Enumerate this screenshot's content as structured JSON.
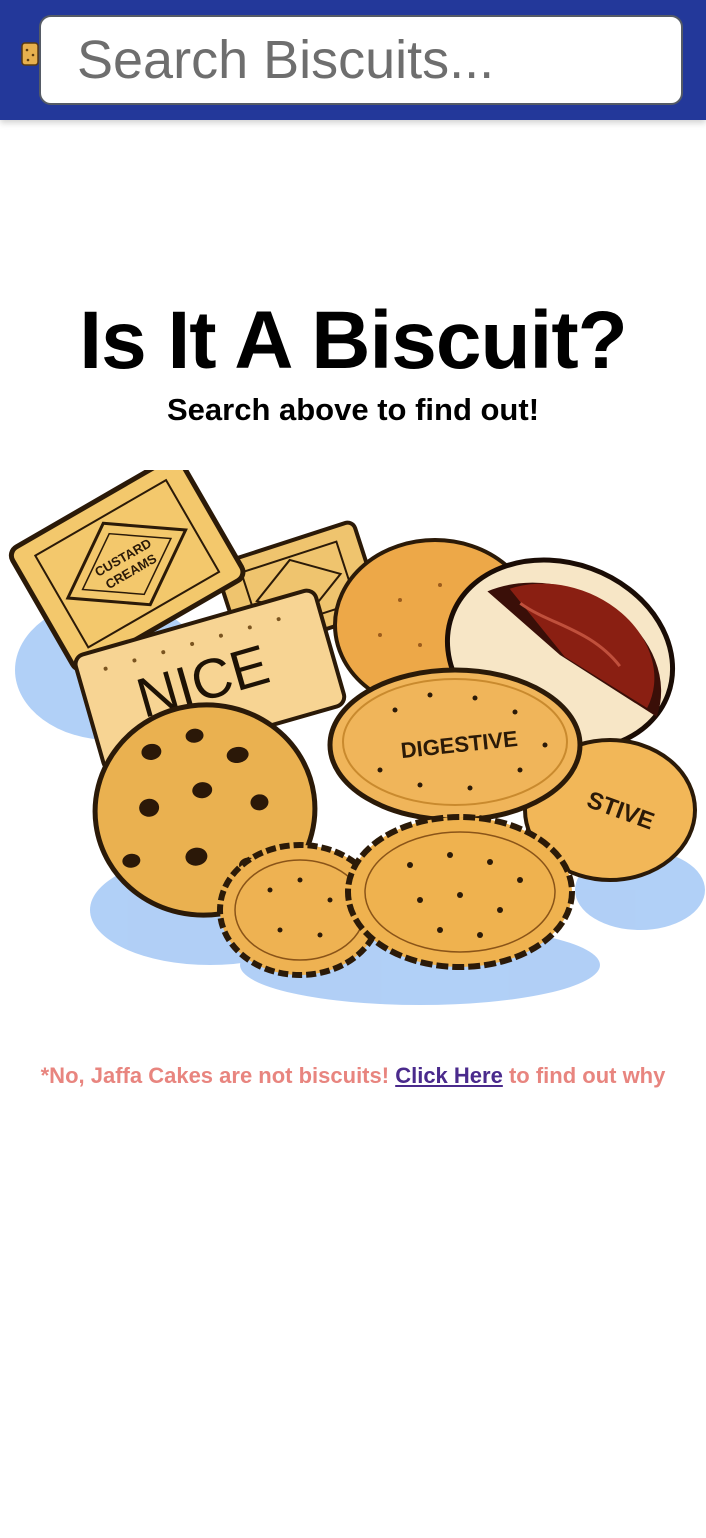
{
  "header": {
    "logo_icon": "biscuit-logo-icon",
    "background_color": "#23389a",
    "search": {
      "placeholder": "Search Biscuits...",
      "value": ""
    }
  },
  "main": {
    "title": "Is It A Biscuit?",
    "subtitle": "Search above to find out!",
    "image_icon": "biscuit-assortment-illustration",
    "biscuit_labels": {
      "custard": "CUSTARD CREAMS",
      "nice": "NICE",
      "digestive_front": "DIGESTIVE",
      "digestive_back": "STIVE"
    }
  },
  "footnote": {
    "prefix": "*No, Jaffa Cakes are not biscuits!",
    "link_label": "Click Here",
    "suffix": "to find out why",
    "text_color": "#e8857f",
    "link_color": "#4a2a8c"
  }
}
